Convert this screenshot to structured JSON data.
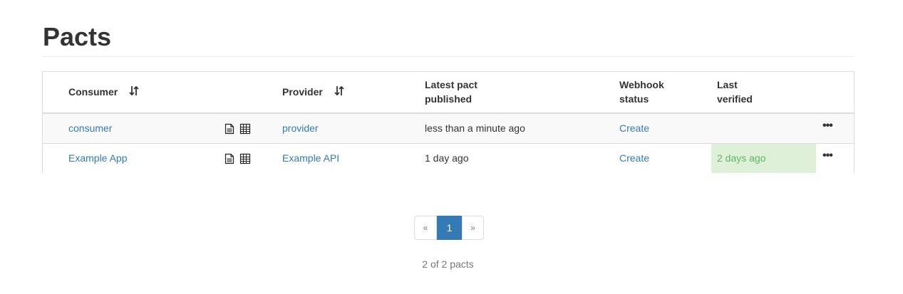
{
  "title": "Pacts",
  "table": {
    "headers": {
      "consumer": "Consumer",
      "provider": "Provider",
      "latest_pact_line1": "Latest pact",
      "latest_pact_line2": "published",
      "webhook_line1": "Webhook",
      "webhook_line2": "status",
      "last_verified_line1": "Last",
      "last_verified_line2": "verified"
    },
    "rows": [
      {
        "consumer": "consumer",
        "provider": "provider",
        "latest_published": "less than a minute ago",
        "webhook_status": "Create",
        "last_verified": "",
        "menu": "•••"
      },
      {
        "consumer": "Example App",
        "provider": "Example API",
        "latest_published": "1 day ago",
        "webhook_status": "Create",
        "last_verified": "2 days ago",
        "menu": "•••"
      }
    ]
  },
  "pagination": {
    "prev": "«",
    "current": "1",
    "next": "»"
  },
  "count_text": "2 of 2 pacts",
  "icons": {
    "sort": "sort-icon",
    "document": "document-icon",
    "matrix": "table-icon",
    "menu": "ellipsis-icon"
  },
  "colors": {
    "link": "#337ab7",
    "verified_bg": "#dff0d8",
    "verified_text": "#5cb85c"
  }
}
